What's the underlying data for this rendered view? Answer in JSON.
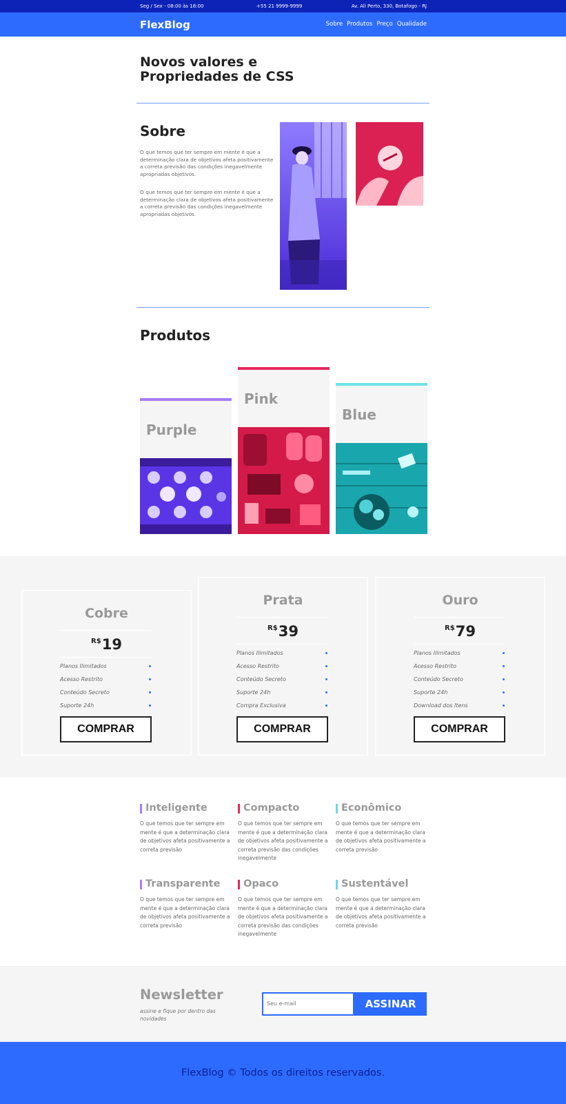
{
  "topbar": {
    "hours": "Seg / Sex - 08:00 às 18:00",
    "phone": "+55 21 9999-9999",
    "address": "Av. Ali Perto, 330, Botafogo - RJ"
  },
  "header": {
    "logo": "FlexBlog",
    "nav": [
      "Sobre",
      "Produtos",
      "Preço",
      "Qualidade"
    ]
  },
  "hero": {
    "title": "Novos valores e Propriedades de CSS"
  },
  "about": {
    "title": "Sobre",
    "paragraphs": [
      "O que temos que ter sempre em mente é que a determinação clara de objetivos afeta positivamente a correta previsão das condições inegavelmente apropriadas objetivos.",
      "O que temos que ter sempre em mente é que a determinação clara de objetivos afeta positivamente a correta previsão das condições inegavelmente apropriadas objetivos."
    ]
  },
  "products": {
    "title": "Produtos",
    "items": [
      {
        "name": "Purple",
        "color": "#a77bff"
      },
      {
        "name": "Pink",
        "color": "#e8275e"
      },
      {
        "name": "Blue",
        "color": "#6fe3e8"
      }
    ]
  },
  "pricing": {
    "currency": "R$",
    "buy_label": "COMPRAR",
    "plans": [
      {
        "name": "Cobre",
        "price": "19",
        "features": [
          "Planos Ilimitados",
          "Acesso Restrito",
          "Conteúdo Secreto",
          "Suporte 24h"
        ]
      },
      {
        "name": "Prata",
        "price": "39",
        "features": [
          "Planos Ilimitados",
          "Acesso Restrito",
          "Conteúdo Secreto",
          "Suporte 24h",
          "Compra Exclusiva"
        ]
      },
      {
        "name": "Ouro",
        "price": "79",
        "features": [
          "Planos Ilimitados",
          "Acesso Restrito",
          "Conteúdo Secreto",
          "Suporte 24h",
          "Download dos Itens"
        ]
      }
    ]
  },
  "features": [
    {
      "title": "Inteligente",
      "color": "#a77bff",
      "text": "O que temos que ter sempre em mente é que a determinação clara de objetivos afeta positivamente a correta previsão"
    },
    {
      "title": "Compacto",
      "color": "#e8275e",
      "text": "O que temos que ter sempre em mente é que a determinação clara de objetivos afeta positivamente a correta previsão das condições inegavelmente"
    },
    {
      "title": "Econômico",
      "color": "#6fd6e8",
      "text": "O que temos que ter sempre em mente é que a determinação clara de objetivos afeta positivamente a correta previsão"
    },
    {
      "title": "Transparente",
      "color": "#a77bff",
      "text": "O que temos que ter sempre em mente é que a determinação clara de objetivos afeta positivamente a correta previsão"
    },
    {
      "title": "Opaco",
      "color": "#e8275e",
      "text": "O que temos que ter sempre em mente é que a determinação clara de objetivos afeta positivamente a correta previsão das condições inegavelmente"
    },
    {
      "title": "Sustentável",
      "color": "#6fd6e8",
      "text": "O que temos que ter sempre em mente é que a determinação clara de objetivos afeta positivamente a correta previsão"
    }
  ],
  "newsletter": {
    "title": "Newsletter",
    "subtitle": "assine e fique por dentro das novidades",
    "placeholder": "Seu e-mail",
    "button": "ASSINAR"
  },
  "footer": {
    "text": "FlexBlog © Todos os direitos reservados."
  },
  "colors": {
    "brand_blue": "#2d6bff",
    "topbar_blue": "#0d23b8"
  }
}
